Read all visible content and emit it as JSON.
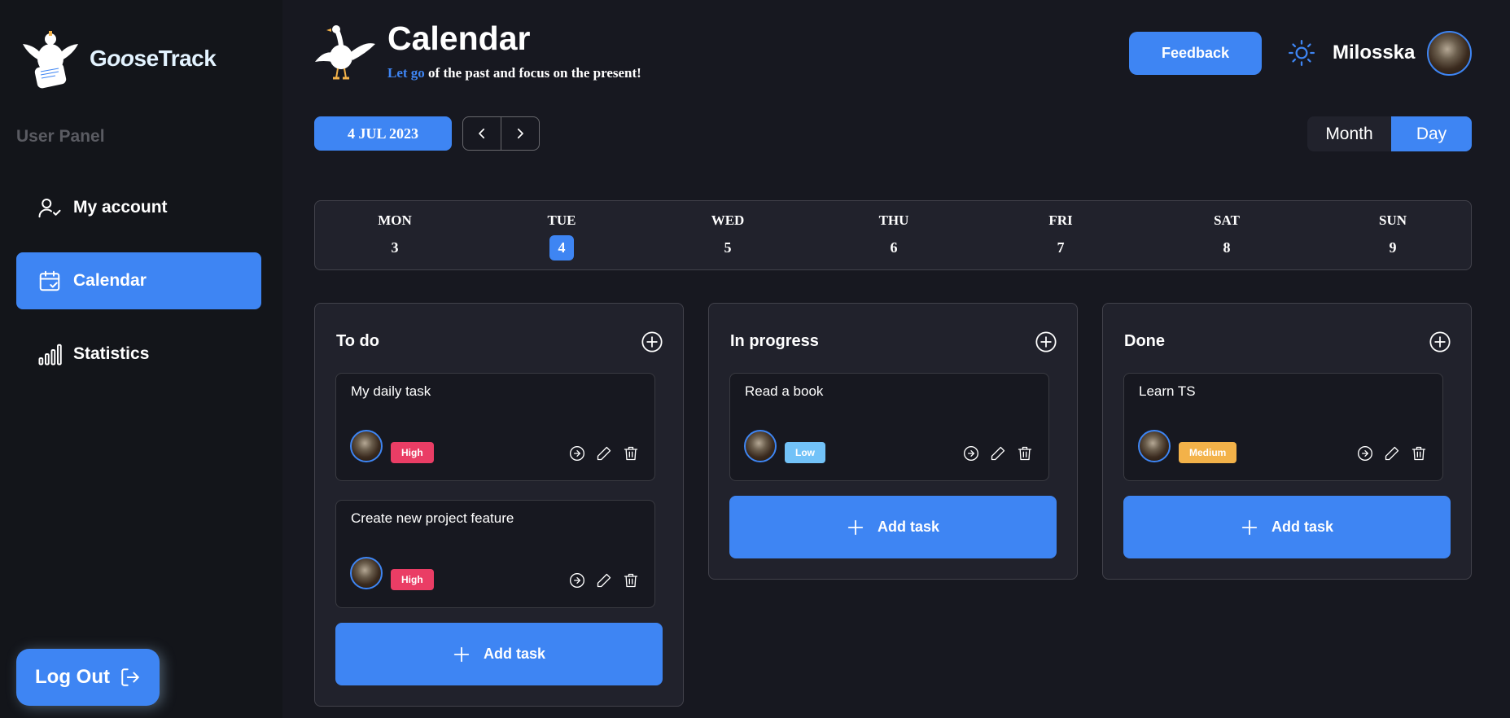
{
  "app": {
    "logo_text": "GooseTrack",
    "logo_text_styled": {
      "first": "G",
      "italic": "oo",
      "rest": "seTrack"
    }
  },
  "sidebar": {
    "panel_label": "User Panel",
    "items": [
      {
        "label": "My account",
        "icon": "user-check-icon",
        "active": false
      },
      {
        "label": "Calendar",
        "icon": "calendar-check-icon",
        "active": true
      },
      {
        "label": "Statistics",
        "icon": "chart-bars-icon",
        "active": false
      }
    ],
    "logout_label": "Log Out"
  },
  "header": {
    "title": "Calendar",
    "motto_accent": "Let go",
    "motto_rest": " of the past and focus on the present!",
    "feedback_label": "Feedback",
    "username": "Milosska"
  },
  "toolbar": {
    "date_label": "4 JUL 2023",
    "view_month": "Month",
    "view_day": "Day",
    "active_view": "Day"
  },
  "week": [
    {
      "name": "MON",
      "num": "3",
      "current": false
    },
    {
      "name": "TUE",
      "num": "4",
      "current": true
    },
    {
      "name": "WED",
      "num": "5",
      "current": false
    },
    {
      "name": "THU",
      "num": "6",
      "current": false
    },
    {
      "name": "FRI",
      "num": "7",
      "current": false
    },
    {
      "name": "SAT",
      "num": "8",
      "current": false
    },
    {
      "name": "SUN",
      "num": "9",
      "current": false
    }
  ],
  "columns": [
    {
      "title": "To do",
      "tasks": [
        {
          "title": "My daily task",
          "priority": "High"
        },
        {
          "title": "Create new project feature",
          "priority": "High"
        }
      ],
      "add_label": "Add task"
    },
    {
      "title": "In progress",
      "tasks": [
        {
          "title": "Read a book",
          "priority": "Low"
        }
      ],
      "add_label": "Add task"
    },
    {
      "title": "Done",
      "tasks": [
        {
          "title": "Learn TS",
          "priority": "Medium"
        }
      ],
      "add_label": "Add task"
    }
  ],
  "colors": {
    "accent": "#3e85f3",
    "background": "#171820",
    "sidebar": "#13151a",
    "surface": "#21222c",
    "priority_high": "#ea3d65",
    "priority_low": "#72c2f8",
    "priority_medium": "#f3b249"
  }
}
